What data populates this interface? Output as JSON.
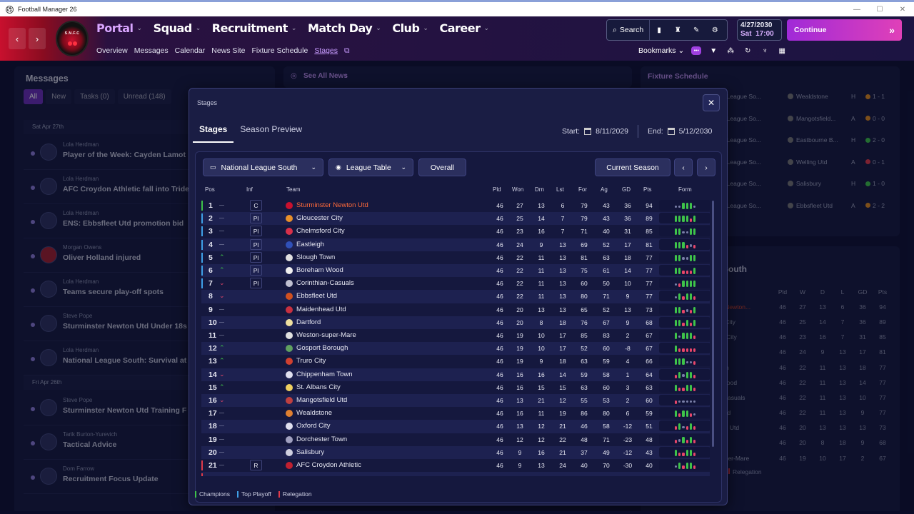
{
  "window": {
    "title": "Football Manager 26",
    "controls": [
      "—",
      "☐",
      "✕"
    ]
  },
  "nav": {
    "main": [
      {
        "label": "Portal",
        "active": true
      },
      {
        "label": "Squad",
        "active": false
      },
      {
        "label": "Recruitment",
        "active": false
      },
      {
        "label": "Match Day",
        "active": false
      },
      {
        "label": "Club",
        "active": false
      },
      {
        "label": "Career",
        "active": false
      }
    ],
    "sub": [
      "Overview",
      "Messages",
      "Calendar",
      "News Site",
      "Fixture Schedule",
      "Stages"
    ],
    "search_label": "Search",
    "date_line1": "4/27/2030",
    "date_line2_day": "Sat",
    "date_line2_time": "17:00",
    "continue_label": "Continue",
    "bookmarks_label": "Bookmarks"
  },
  "crest": {
    "text": "S.N.F.C"
  },
  "messages": {
    "title": "Messages",
    "tabs": [
      "All",
      "New",
      "Tasks (0)",
      "Unread (148)"
    ],
    "groups": [
      {
        "date": "Sat Apr 27th",
        "items": [
          {
            "from": "Lola Herdman",
            "subject": "Player of the Week: Cayden Lamot",
            "icon": "whistle-icon",
            "red": false
          },
          {
            "from": "Lola Herdman",
            "subject": "AFC Croydon Athletic fall into Tride",
            "icon": "whistle-icon",
            "red": false
          },
          {
            "from": "Lola Herdman",
            "subject": "ENS: Ebbsfleet Utd promotion bid",
            "icon": "whistle-icon",
            "red": false
          },
          {
            "from": "Morgan Owens",
            "subject": "Oliver Holland injured",
            "icon": "medical-cross-icon",
            "red": true
          },
          {
            "from": "Lola Herdman",
            "subject": "Teams secure play-off spots",
            "icon": "whistle-icon",
            "red": false
          },
          {
            "from": "Steve Pope",
            "subject": "Sturminster Newton Utd Under 18s",
            "icon": "staff-icon",
            "red": false
          },
          {
            "from": "Lola Herdman",
            "subject": "National League South: Survival at",
            "icon": "whistle-icon",
            "red": false
          }
        ]
      },
      {
        "date": "Fri Apr 26th",
        "items": [
          {
            "from": "Steve Pope",
            "subject": "Sturminster Newton Utd Training F",
            "icon": "staff-icon",
            "red": false
          },
          {
            "from": "Tarik Burton-Yurevich",
            "subject": "Tactical Advice",
            "icon": "staff-icon",
            "red": false
          },
          {
            "from": "Dom Farrow",
            "subject": "Recruitment Focus Update",
            "icon": "scout-icon",
            "red": false
          }
        ]
      }
    ]
  },
  "news": {
    "link_label": "See All News"
  },
  "fixtures": {
    "title": "Fixture Schedule",
    "rows": [
      {
        "comp": "tional League So...",
        "opp": "Wealdstone",
        "ha": "H",
        "result": "1 - 1",
        "color": "#e08a20"
      },
      {
        "comp": "tional League So...",
        "opp": "Mangotsfield...",
        "ha": "A",
        "result": "0 - 0",
        "color": "#e08a20"
      },
      {
        "comp": "tional League So...",
        "opp": "Eastbourne B...",
        "ha": "H",
        "result": "2 - 0",
        "color": "#3ec44a"
      },
      {
        "comp": "tional League So...",
        "opp": "Welling Utd",
        "ha": "A",
        "result": "0 - 1",
        "color": "#e03a4a"
      },
      {
        "comp": "tional League So...",
        "opp": "Salisbury",
        "ha": "H",
        "result": "1 - 0",
        "color": "#3ec44a"
      },
      {
        "comp": "tional League So...",
        "opp": "Ebbsfleet Utd",
        "ha": "A",
        "result": "2 - 2",
        "color": "#e08a20"
      }
    ]
  },
  "bg_league": {
    "title_fragment": "South",
    "headers": [
      "Pld",
      "W",
      "D",
      "L",
      "GD",
      "Pts"
    ],
    "rows": [
      {
        "team": "r Newton...",
        "v": [
          "46",
          "27",
          "13",
          "6",
          "36",
          "94"
        ],
        "hl": true
      },
      {
        "team": "r City",
        "v": [
          "46",
          "25",
          "14",
          "7",
          "36",
          "89"
        ],
        "hl": false
      },
      {
        "team": "d City",
        "v": [
          "46",
          "23",
          "16",
          "7",
          "31",
          "85"
        ],
        "hl": false
      },
      {
        "team": "",
        "v": [
          "46",
          "24",
          "9",
          "13",
          "17",
          "81"
        ],
        "hl": false
      },
      {
        "team": "wn",
        "v": [
          "46",
          "22",
          "11",
          "13",
          "18",
          "77"
        ],
        "hl": false
      },
      {
        "team": "Wood",
        "v": [
          "46",
          "22",
          "11",
          "13",
          "14",
          "77"
        ],
        "hl": false
      },
      {
        "team": "-Casuals",
        "v": [
          "46",
          "22",
          "11",
          "13",
          "10",
          "77"
        ],
        "hl": false
      },
      {
        "team": "Utd",
        "v": [
          "46",
          "22",
          "11",
          "13",
          "9",
          "77"
        ],
        "hl": false
      },
      {
        "team": "ad Utd",
        "v": [
          "46",
          "20",
          "13",
          "13",
          "13",
          "73"
        ],
        "hl": false
      },
      {
        "team": "",
        "v": [
          "46",
          "20",
          "8",
          "18",
          "9",
          "68"
        ],
        "hl": false
      },
      {
        "team": "uper-Mare",
        "v": [
          "46",
          "19",
          "10",
          "17",
          "2",
          "67"
        ],
        "hl": false
      }
    ],
    "legend": "Relegation"
  },
  "modal": {
    "title": "Stages",
    "tabs": [
      "Stages",
      "Season Preview"
    ],
    "start_label": "Start:",
    "start_date": "8/11/2029",
    "end_label": "End:",
    "end_date": "5/12/2030",
    "competition": "National League South",
    "view": "League Table",
    "filter": "Overall",
    "season_button": "Current Season",
    "columns": [
      "Pos",
      "Inf",
      "Team",
      "Pld",
      "Won",
      "Drn",
      "Lst",
      "For",
      "Ag",
      "GD",
      "Pts",
      "Form"
    ],
    "legend": [
      "Champions",
      "Top Playoff",
      "Relegation"
    ],
    "colors": {
      "champions": "#3ec44a",
      "playoff": "#3fa0e8",
      "relegation": "#e03a4a",
      "win": "#3ec44a",
      "draw": "#7a7fa8",
      "loss": "#e8466a",
      "user_team": "#ff6a3a"
    },
    "table": [
      {
        "pos": "1",
        "move": "same",
        "inf": "C",
        "team": "Sturminster Newton Utd",
        "pld": "46",
        "won": "27",
        "drn": "13",
        "lst": "6",
        "for": "79",
        "ag": "43",
        "gd": "36",
        "pts": "94",
        "zone": "champions",
        "user": true,
        "logo": "#c8102e",
        "form": "DDWWWD"
      },
      {
        "pos": "2",
        "move": "same",
        "inf": "Pl",
        "team": "Gloucester City",
        "pld": "46",
        "won": "25",
        "drn": "14",
        "lst": "7",
        "for": "79",
        "ag": "43",
        "gd": "36",
        "pts": "89",
        "zone": "playoff",
        "logo": "#e8902a",
        "form": "WWWWLW"
      },
      {
        "pos": "3",
        "move": "same",
        "inf": "Pl",
        "team": "Chelmsford City",
        "pld": "46",
        "won": "23",
        "drn": "16",
        "lst": "7",
        "for": "71",
        "ag": "40",
        "gd": "31",
        "pts": "85",
        "zone": "playoff",
        "logo": "#d8304a",
        "form": "WWDDWW"
      },
      {
        "pos": "4",
        "move": "same",
        "inf": "Pl",
        "team": "Eastleigh",
        "pld": "46",
        "won": "24",
        "drn": "9",
        "lst": "13",
        "for": "69",
        "ag": "52",
        "gd": "17",
        "pts": "81",
        "zone": "playoff",
        "logo": "#3050b8",
        "form": "WWWLDL"
      },
      {
        "pos": "5",
        "move": "up",
        "inf": "Pl",
        "team": "Slough Town",
        "pld": "46",
        "won": "22",
        "drn": "11",
        "lst": "13",
        "for": "81",
        "ag": "63",
        "gd": "18",
        "pts": "77",
        "zone": "playoff",
        "logo": "#e0e0e0",
        "form": "WWDDWW"
      },
      {
        "pos": "6",
        "move": "up",
        "inf": "Pl",
        "team": "Boreham Wood",
        "pld": "46",
        "won": "22",
        "drn": "11",
        "lst": "13",
        "for": "75",
        "ag": "61",
        "gd": "14",
        "pts": "77",
        "zone": "playoff",
        "logo": "#f0f0f0",
        "form": "WWLLLW"
      },
      {
        "pos": "7",
        "move": "down",
        "inf": "Pl",
        "team": "Corinthian-Casuals",
        "pld": "46",
        "won": "22",
        "drn": "11",
        "lst": "13",
        "for": "60",
        "ag": "50",
        "gd": "10",
        "pts": "77",
        "zone": "playoff",
        "logo": "#c0c0d0",
        "form": "DLWWWW"
      },
      {
        "pos": "8",
        "move": "down",
        "inf": "",
        "team": "Ebbsfleet Utd",
        "pld": "46",
        "won": "22",
        "drn": "11",
        "lst": "13",
        "for": "80",
        "ag": "71",
        "gd": "9",
        "pts": "77",
        "zone": "",
        "logo": "#d05020",
        "form": "DWLWWL"
      },
      {
        "pos": "9",
        "move": "same",
        "inf": "",
        "team": "Maidenhead Utd",
        "pld": "46",
        "won": "20",
        "drn": "13",
        "lst": "13",
        "for": "65",
        "ag": "52",
        "gd": "13",
        "pts": "73",
        "zone": "",
        "logo": "#c83040",
        "form": "WWLDLW"
      },
      {
        "pos": "10",
        "move": "same",
        "inf": "",
        "team": "Dartford",
        "pld": "46",
        "won": "20",
        "drn": "8",
        "lst": "18",
        "for": "76",
        "ag": "67",
        "gd": "9",
        "pts": "68",
        "zone": "",
        "logo": "#f0e0a0",
        "form": "WWLWLW"
      },
      {
        "pos": "11",
        "move": "same",
        "inf": "",
        "team": "Weston-super-Mare",
        "pld": "46",
        "won": "19",
        "drn": "10",
        "lst": "17",
        "for": "85",
        "ag": "83",
        "gd": "2",
        "pts": "67",
        "zone": "",
        "logo": "#e0e0e0",
        "form": "WDWWWL"
      },
      {
        "pos": "12",
        "move": "up",
        "inf": "",
        "team": "Gosport Borough",
        "pld": "46",
        "won": "19",
        "drn": "10",
        "lst": "17",
        "for": "52",
        "ag": "60",
        "gd": "-8",
        "pts": "67",
        "zone": "",
        "logo": "#60a060",
        "form": "WLLLLL"
      },
      {
        "pos": "13",
        "move": "up",
        "inf": "",
        "team": "Truro City",
        "pld": "46",
        "won": "19",
        "drn": "9",
        "lst": "18",
        "for": "63",
        "ag": "59",
        "gd": "4",
        "pts": "66",
        "zone": "",
        "logo": "#d04030",
        "form": "WWWDDL"
      },
      {
        "pos": "14",
        "move": "down",
        "inf": "",
        "team": "Chippenham Town",
        "pld": "46",
        "won": "16",
        "drn": "16",
        "lst": "14",
        "for": "59",
        "ag": "58",
        "gd": "1",
        "pts": "64",
        "zone": "",
        "logo": "#e0e0f0",
        "form": "LWDWWL"
      },
      {
        "pos": "15",
        "move": "up",
        "inf": "",
        "team": "St. Albans City",
        "pld": "46",
        "won": "16",
        "drn": "15",
        "lst": "15",
        "for": "63",
        "ag": "60",
        "gd": "3",
        "pts": "63",
        "zone": "",
        "logo": "#f0d060",
        "form": "WLLWWL"
      },
      {
        "pos": "16",
        "move": "down",
        "inf": "",
        "team": "Mangotsfield Utd",
        "pld": "46",
        "won": "13",
        "drn": "21",
        "lst": "12",
        "for": "55",
        "ag": "53",
        "gd": "2",
        "pts": "60",
        "zone": "",
        "logo": "#c04040",
        "form": "LDDDDD"
      },
      {
        "pos": "17",
        "move": "same",
        "inf": "",
        "team": "Wealdstone",
        "pld": "46",
        "won": "16",
        "drn": "11",
        "lst": "19",
        "for": "86",
        "ag": "80",
        "gd": "6",
        "pts": "59",
        "zone": "",
        "logo": "#e08030",
        "form": "WLWWLD"
      },
      {
        "pos": "18",
        "move": "same",
        "inf": "",
        "team": "Oxford City",
        "pld": "46",
        "won": "13",
        "drn": "12",
        "lst": "21",
        "for": "46",
        "ag": "58",
        "gd": "-12",
        "pts": "51",
        "zone": "",
        "logo": "#e0e0f0",
        "form": "LWDLWL"
      },
      {
        "pos": "19",
        "move": "same",
        "inf": "",
        "team": "Dorchester Town",
        "pld": "46",
        "won": "12",
        "drn": "12",
        "lst": "22",
        "for": "48",
        "ag": "71",
        "gd": "-23",
        "pts": "48",
        "zone": "",
        "logo": "#a0a0c0",
        "form": "LDWLWL"
      },
      {
        "pos": "20",
        "move": "same",
        "inf": "",
        "team": "Salisbury",
        "pld": "46",
        "won": "9",
        "drn": "16",
        "lst": "21",
        "for": "37",
        "ag": "49",
        "gd": "-12",
        "pts": "43",
        "zone": "",
        "logo": "#d0d0e0",
        "form": "WLLWWL"
      },
      {
        "pos": "21",
        "move": "same",
        "inf": "R",
        "team": "AFC Croydon Athletic",
        "pld": "46",
        "won": "9",
        "drn": "13",
        "lst": "24",
        "for": "40",
        "ag": "70",
        "gd": "-30",
        "pts": "40",
        "zone": "relegation",
        "logo": "#c02030",
        "form": "DWLWWL"
      }
    ]
  }
}
